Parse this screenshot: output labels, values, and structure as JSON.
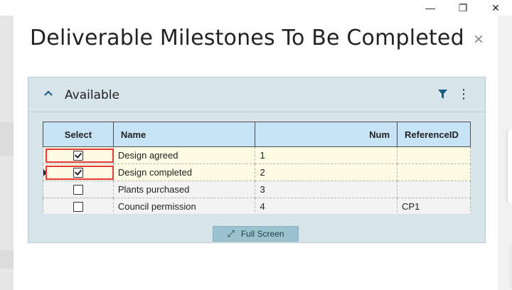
{
  "window_controls": {
    "minimize": "—",
    "restore": "❐",
    "close": "✕"
  },
  "dialog": {
    "title": "Deliverable Milestones To Be Completed",
    "close_glyph": "×"
  },
  "panel": {
    "title": "Available",
    "collapse_glyph": "︿",
    "more_glyph": "⋮"
  },
  "grid": {
    "columns": [
      "Select",
      "Name",
      "Num",
      "ReferenceID"
    ],
    "rows": [
      {
        "checked": true,
        "name": "Design agreed",
        "num": "1",
        "ref": ""
      },
      {
        "checked": true,
        "name": "Design completed",
        "num": "2",
        "ref": ""
      },
      {
        "checked": false,
        "name": "Plants purchased",
        "num": "3",
        "ref": ""
      },
      {
        "checked": false,
        "name": "Council permission",
        "num": "4",
        "ref": "CP1"
      }
    ]
  },
  "fullscreen_button": {
    "label": "Full Screen",
    "icon": "⤢"
  },
  "colors": {
    "accent": "#1d5b82",
    "panel_bg": "#d7e4ea",
    "header_bg": "#c7e4f7",
    "highlight_row": "#fdfbe4",
    "focus_border": "#e53935"
  }
}
